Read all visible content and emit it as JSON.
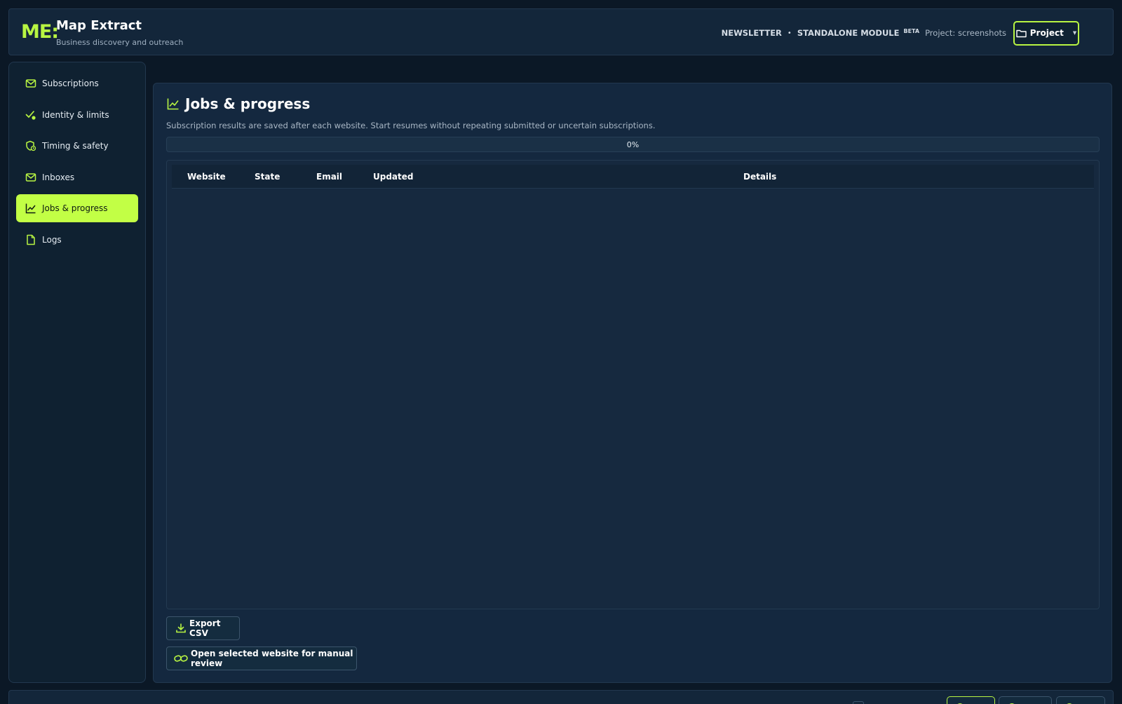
{
  "brand": {
    "logo": "ME:",
    "title": "Map Extract",
    "subtitle": "Business discovery and outreach",
    "accent_color": "#b8f542"
  },
  "header": {
    "module": "NEWSLETTER",
    "separator": "•",
    "module_type": "STANDALONE MODULE",
    "badge": "BETA",
    "project_label": "Project: screenshots",
    "project_button": "Project",
    "project_icon": "folder-icon",
    "project_caret": "▼"
  },
  "sidebar": {
    "items": [
      {
        "label": "Subscriptions",
        "icon": "mail-icon",
        "active": false
      },
      {
        "label": "Identity & limits",
        "icon": "check-badge-icon",
        "active": false
      },
      {
        "label": "Timing & safety",
        "icon": "shield-clock-icon",
        "active": false
      },
      {
        "label": "Inboxes",
        "icon": "mail-icon",
        "active": false
      },
      {
        "label": "Jobs & progress",
        "icon": "line-chart-icon",
        "active": true
      },
      {
        "label": "Logs",
        "icon": "document-icon",
        "active": false
      }
    ]
  },
  "main": {
    "title": "Jobs & progress",
    "title_icon": "line-chart-icon",
    "description": "Subscription results are saved after each website. Start resumes without repeating submitted or uncertain subscriptions.",
    "progress": {
      "value": 0,
      "label": "0%"
    },
    "table": {
      "columns": [
        "Website",
        "State",
        "Email",
        "Updated",
        "Details"
      ],
      "rows": []
    },
    "buttons": {
      "export_csv": "Export CSV",
      "manual_review": "Open selected website for manual review"
    }
  }
}
